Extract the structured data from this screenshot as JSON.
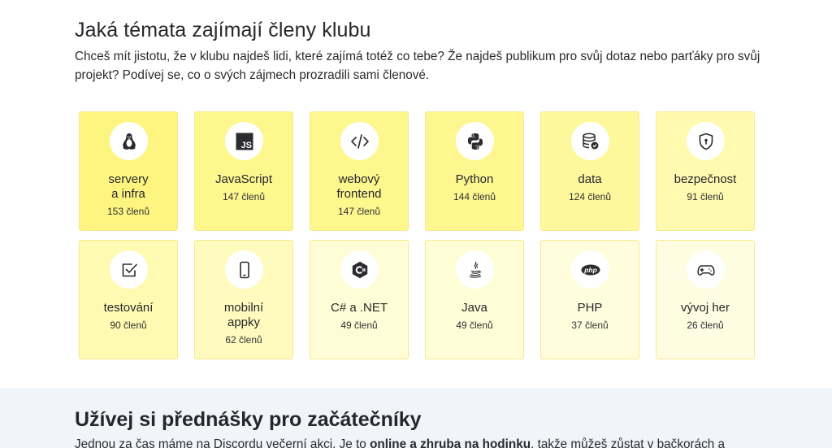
{
  "topics": {
    "title": "Jaká témata zajímají členy klubu",
    "lead": "Chceš mít jistotu, že v klubu najdeš lidi, které zajímá totéž co tebe? Že najdeš publikum pro svůj dotaz nebo parťáky pro svůj projekt? Podívej se, co o svých zájmech prozradili sami členové.",
    "cards": [
      {
        "name": "servery\na infra",
        "count": "153 členů",
        "icon": "linux-tux-icon",
        "color": "#fef581"
      },
      {
        "name": "JavaScript",
        "count": "147 členů",
        "icon": "javascript-icon",
        "color": "#fef78e"
      },
      {
        "name": "webový\nfrontend",
        "count": "147 členů",
        "icon": "code-icon",
        "color": "#fef78e"
      },
      {
        "name": "Python",
        "count": "144 členů",
        "icon": "python-icon",
        "color": "#fef790"
      },
      {
        "name": "data",
        "count": "124 členů",
        "icon": "database-icon",
        "color": "#fef89c"
      },
      {
        "name": "bezpečnost",
        "count": "91 členů",
        "icon": "shield-icon",
        "color": "#fffab0"
      },
      {
        "name": "testování",
        "count": "90 členů",
        "icon": "checkbox-icon",
        "color": "#fffab1"
      },
      {
        "name": "mobilní\nappky",
        "count": "62 členů",
        "icon": "smartphone-icon",
        "color": "#fffbbe"
      },
      {
        "name": "C# a .NET",
        "count": "49 členů",
        "icon": "csharp-icon",
        "color": "#fffdd6"
      },
      {
        "name": "Java",
        "count": "49 členů",
        "icon": "java-icon",
        "color": "#fffdd6"
      },
      {
        "name": "PHP",
        "count": "37 členů",
        "icon": "php-icon",
        "color": "#fffddb"
      },
      {
        "name": "vývoj her",
        "count": "26 členů",
        "icon": "gamepad-icon",
        "color": "#fffde1"
      }
    ]
  },
  "next": {
    "title": "Užívej si přednášky pro začátečníky",
    "lead_before": "Jednou za čas máme na Discordu večerní akci. Je to ",
    "lead_bold": "online a zhruba na hodinku",
    "lead_after": ", takže můžeš zůstat v bačkorách a"
  }
}
